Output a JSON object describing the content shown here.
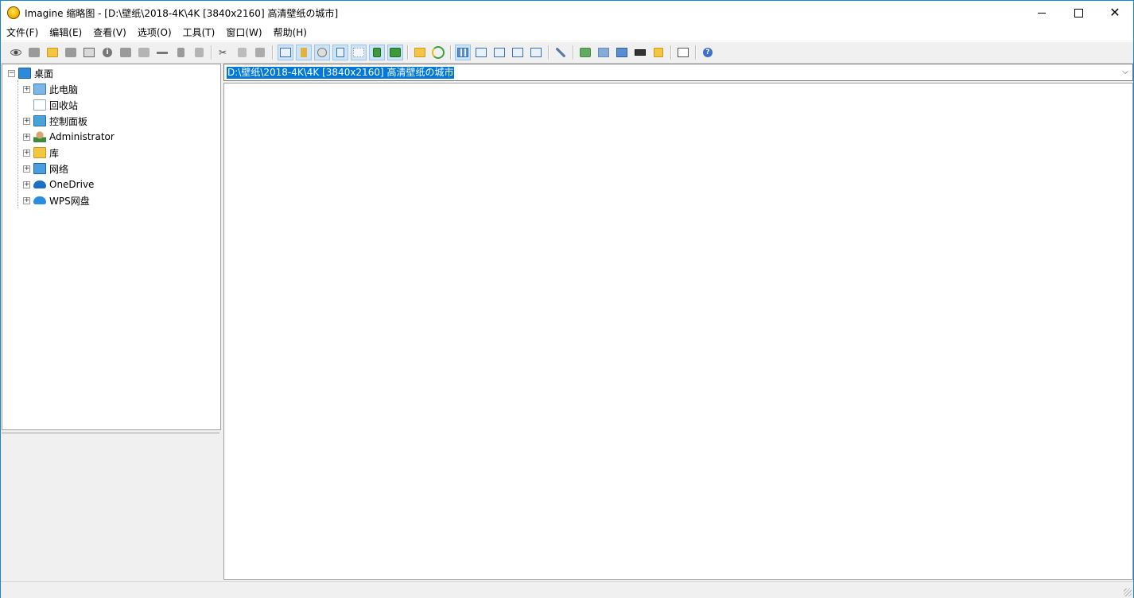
{
  "window": {
    "title": "Imagine 缩略图 - [D:\\壁纸\\2018-4K\\4K [3840x2160] 高清壁纸の城市]",
    "controls": {
      "minimize": "minimize",
      "maximize": "maximize",
      "close": "✕"
    }
  },
  "menu": [
    "文件(F)",
    "编辑(E)",
    "查看(V)",
    "选项(O)",
    "工具(T)",
    "窗口(W)",
    "帮助(H)"
  ],
  "tree": {
    "root": {
      "label": "桌面",
      "expanded": true
    },
    "items": [
      {
        "label": "此电脑",
        "icon": "computer-icon",
        "expandable": true
      },
      {
        "label": "回收站",
        "icon": "recycle-bin-icon",
        "expandable": false
      },
      {
        "label": "控制面板",
        "icon": "control-panel-icon",
        "expandable": true
      },
      {
        "label": "Administrator",
        "icon": "user-folder-icon",
        "expandable": true
      },
      {
        "label": "库",
        "icon": "library-icon",
        "expandable": true
      },
      {
        "label": "网络",
        "icon": "network-icon",
        "expandable": true
      },
      {
        "label": "OneDrive",
        "icon": "onedrive-icon",
        "expandable": true
      },
      {
        "label": "WPS网盘",
        "icon": "wps-cloud-icon",
        "expandable": true
      }
    ]
  },
  "address": {
    "value": "D:\\壁纸\\2018-4K\\4K [3840x2160] 高清壁纸の城市",
    "dropdown_icon": "chevron-down-icon"
  },
  "toolbar": {
    "buttons": [
      "view-icon",
      "slideshow-icon",
      "open-folder-icon",
      "save-icon",
      "print-icon",
      "info-icon",
      "scan-icon",
      "acquire-icon",
      "rename-icon",
      "delete-icon",
      "properties-icon",
      "cut-icon",
      "copy-icon",
      "paste-icon",
      "filmstrip-icon",
      "folder-tree-icon",
      "preview-icon",
      "explorer-icon",
      "thumbnail-icon",
      "fit-icon",
      "image-icon",
      "up-folder-icon",
      "refresh-icon",
      "thumbnails-view-icon",
      "large-icons-icon",
      "small-icons-icon",
      "list-icon",
      "details-icon",
      "settings-icon",
      "batch-convert-icon",
      "batch-rename-icon",
      "capture-icon",
      "film-icon",
      "edit-icon",
      "notes-icon",
      "help-icon"
    ]
  }
}
